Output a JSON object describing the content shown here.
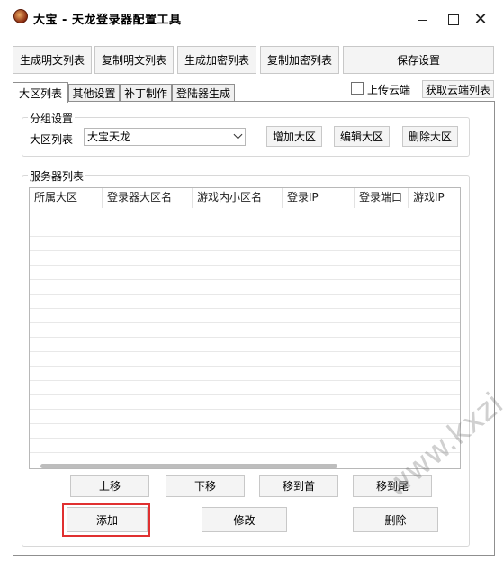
{
  "window": {
    "title": "大宝 - 天龙登录器配置工具"
  },
  "toolbar": {
    "gen_plain": "生成明文列表",
    "copy_plain": "复制明文列表",
    "gen_encrypted": "生成加密列表",
    "copy_encrypted": "复制加密列表",
    "save_settings": "保存设置"
  },
  "tabs": [
    {
      "label": "大区列表"
    },
    {
      "label": "其他设置"
    },
    {
      "label": "补丁制作"
    },
    {
      "label": "登陆器生成"
    }
  ],
  "cloud": {
    "upload_label": "上传云端",
    "upload_checked": false,
    "fetch_label": "获取云端列表"
  },
  "group": {
    "title": "分组设置",
    "region_label": "大区列表",
    "region_value": "大宝天龙",
    "add": "增加大区",
    "edit": "编辑大区",
    "delete": "删除大区"
  },
  "servers": {
    "title": "服务器列表",
    "columns": [
      "所属大区",
      "登录器大区名",
      "游戏内小区名",
      "登录IP",
      "登录端口",
      "游戏IP"
    ],
    "rows": []
  },
  "actions": {
    "move_up": "上移",
    "move_down": "下移",
    "move_first": "移到首",
    "move_last": "移到尾",
    "add": "添加",
    "modify": "修改",
    "delete": "删除"
  },
  "watermark": "www.kxzi.cn",
  "colors": {
    "highlight": "#e03030"
  }
}
